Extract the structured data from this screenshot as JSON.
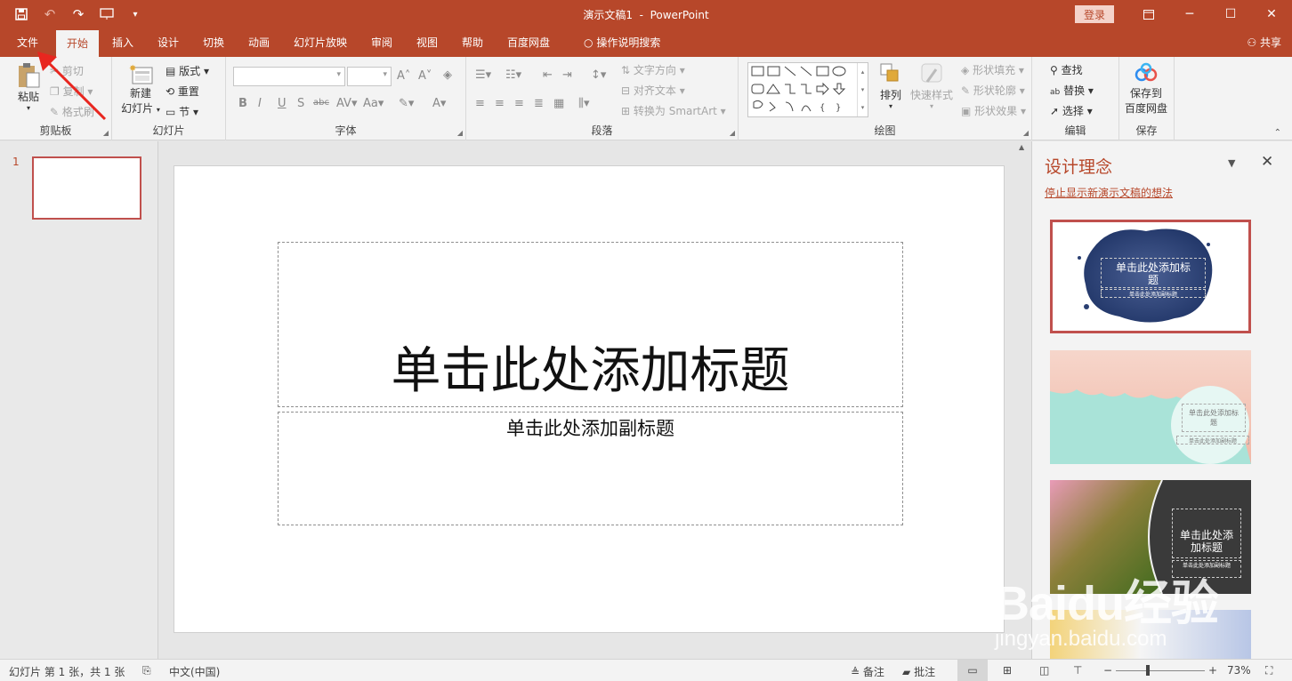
{
  "window": {
    "doc_title": "演示文稿1",
    "app_name": "PowerPoint",
    "separator": "-",
    "login_label": "登录"
  },
  "tabs": [
    {
      "label": "文件"
    },
    {
      "label": "开始",
      "active": true
    },
    {
      "label": "插入"
    },
    {
      "label": "设计"
    },
    {
      "label": "切换"
    },
    {
      "label": "动画"
    },
    {
      "label": "幻灯片放映"
    },
    {
      "label": "审阅"
    },
    {
      "label": "视图"
    },
    {
      "label": "帮助"
    },
    {
      "label": "百度网盘"
    },
    {
      "label": "操作说明搜索"
    }
  ],
  "share_label": "共享",
  "ribbon": {
    "clipboard": {
      "label": "剪贴板",
      "paste": "粘贴",
      "cut": "剪切",
      "copy": "复制",
      "format_painter": "格式刷"
    },
    "slides": {
      "label": "幻灯片",
      "new_slide_1": "新建",
      "new_slide_2": "幻灯片",
      "layout": "版式",
      "reset": "重置",
      "section": "节"
    },
    "font": {
      "label": "字体"
    },
    "paragraph": {
      "label": "段落",
      "text_direction": "文字方向",
      "align_text": "对齐文本",
      "smartart": "转换为 SmartArt"
    },
    "drawing": {
      "label": "绘图",
      "arrange": "排列",
      "quick_styles": "快速样式",
      "shape_fill": "形状填充",
      "shape_outline": "形状轮廓",
      "shape_effects": "形状效果"
    },
    "editing": {
      "label": "编辑",
      "find": "查找",
      "replace": "替换",
      "select": "选择"
    },
    "save": {
      "label": "保存",
      "save_to_1": "保存到",
      "save_to_2": "百度网盘"
    }
  },
  "thumbnails": [
    {
      "number": "1"
    }
  ],
  "slide": {
    "title_placeholder": "单击此处添加标题",
    "subtitle_placeholder": "单击此处添加副标题"
  },
  "design_ideas": {
    "title": "设计理念",
    "stop_link": "停止显示新演示文稿的想法",
    "ideas": [
      {
        "title_1": "单击此处添加标",
        "title_2": "题",
        "subtitle": "单击此处添加副标题"
      },
      {
        "title_1": "单击此处添加标",
        "title_2": "题",
        "subtitle": "单击此处添加副标题"
      },
      {
        "title_1": "单击此处添",
        "title_2": "加标题",
        "subtitle": "单击此处添加副标题"
      }
    ]
  },
  "status": {
    "slide_info": "幻灯片 第 1 张，共 1 张",
    "language": "中文(中国)",
    "notes": "备注",
    "comments": "批注",
    "zoom": "73%"
  },
  "watermark": {
    "big": "Baidu经验",
    "small": "jingyan.baidu.com"
  },
  "colors": {
    "accent": "#b7472a",
    "selection": "#c0504d"
  }
}
